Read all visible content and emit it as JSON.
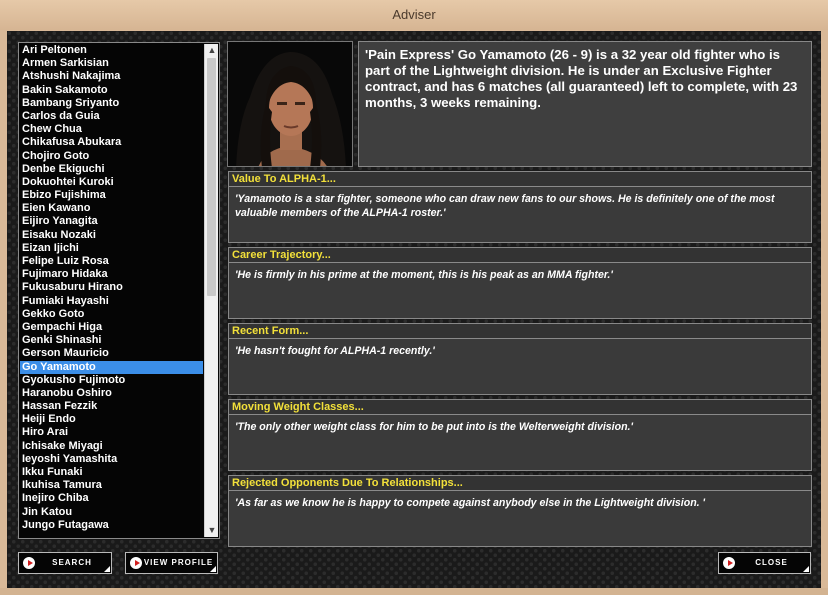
{
  "window": {
    "title": "Adviser"
  },
  "fighters": [
    "Ari Peltonen",
    "Armen Sarkisian",
    "Atshushi Nakajima",
    "Bakin Sakamoto",
    "Bambang Sriyanto",
    "Carlos da Guia",
    "Chew Chua",
    "Chikafusa Abukara",
    "Chojiro Goto",
    "Denbe Ekiguchi",
    "Dokuohtei Kuroki",
    "Ebizo Fujishima",
    "Eien Kawano",
    "Eijiro Yanagita",
    "Eisaku Nozaki",
    "Eizan Ijichi",
    "Felipe Luiz Rosa",
    "Fujimaro Hidaka",
    "Fukusaburu Hirano",
    "Fumiaki Hayashi",
    "Gekko Goto",
    "Gempachi Higa",
    "Genki Shinashi",
    "Gerson Mauricio",
    "Go Yamamoto",
    "Gyokusho Fujimoto",
    "Haranobu Oshiro",
    "Hassan Fezzik",
    "Heiji Endo",
    "Hiro Arai",
    "Ichisake Miyagi",
    "Ieyoshi Yamashita",
    "Ikku Funaki",
    "Ikuhisa Tamura",
    "Inejiro Chiba",
    "Jin Katou",
    "Jungo Futagawa"
  ],
  "selected_fighter": "Go Yamamoto",
  "bio": "'Pain Express' Go Yamamoto  (26 - 9) is a 32 year old fighter who is part of the Lightweight division. He is under an Exclusive Fighter contract, and has 6 matches (all guaranteed) left to complete, with 23 months, 3 weeks remaining.",
  "sections": [
    {
      "title": "Value To ALPHA-1...",
      "text": "'Yamamoto is a star fighter, someone who can draw new fans to our shows. He is definitely one of the most valuable members of the ALPHA-1 roster.'"
    },
    {
      "title": "Career Trajectory...",
      "text": "'He is firmly in his prime at the moment, this is his peak as an MMA fighter.'"
    },
    {
      "title": "Recent Form...",
      "text": "'He hasn't fought for ALPHA-1 recently.'"
    },
    {
      "title": "Moving Weight Classes...",
      "text": "'The only other weight class for him to be put into is the Welterweight division.'"
    },
    {
      "title": "Rejected Opponents Due To Relationships...",
      "text": "'As far as we know he is happy to compete against anybody else in the Lightweight division. '"
    }
  ],
  "buttons": {
    "search": "SEARCH",
    "view_profile": "VIEW PROFILE",
    "close": "CLOSE"
  },
  "icons": {
    "scroll_up": "scroll-up-arrow-icon",
    "scroll_down": "scroll-down-arrow-icon",
    "button": "red-play-icon"
  }
}
